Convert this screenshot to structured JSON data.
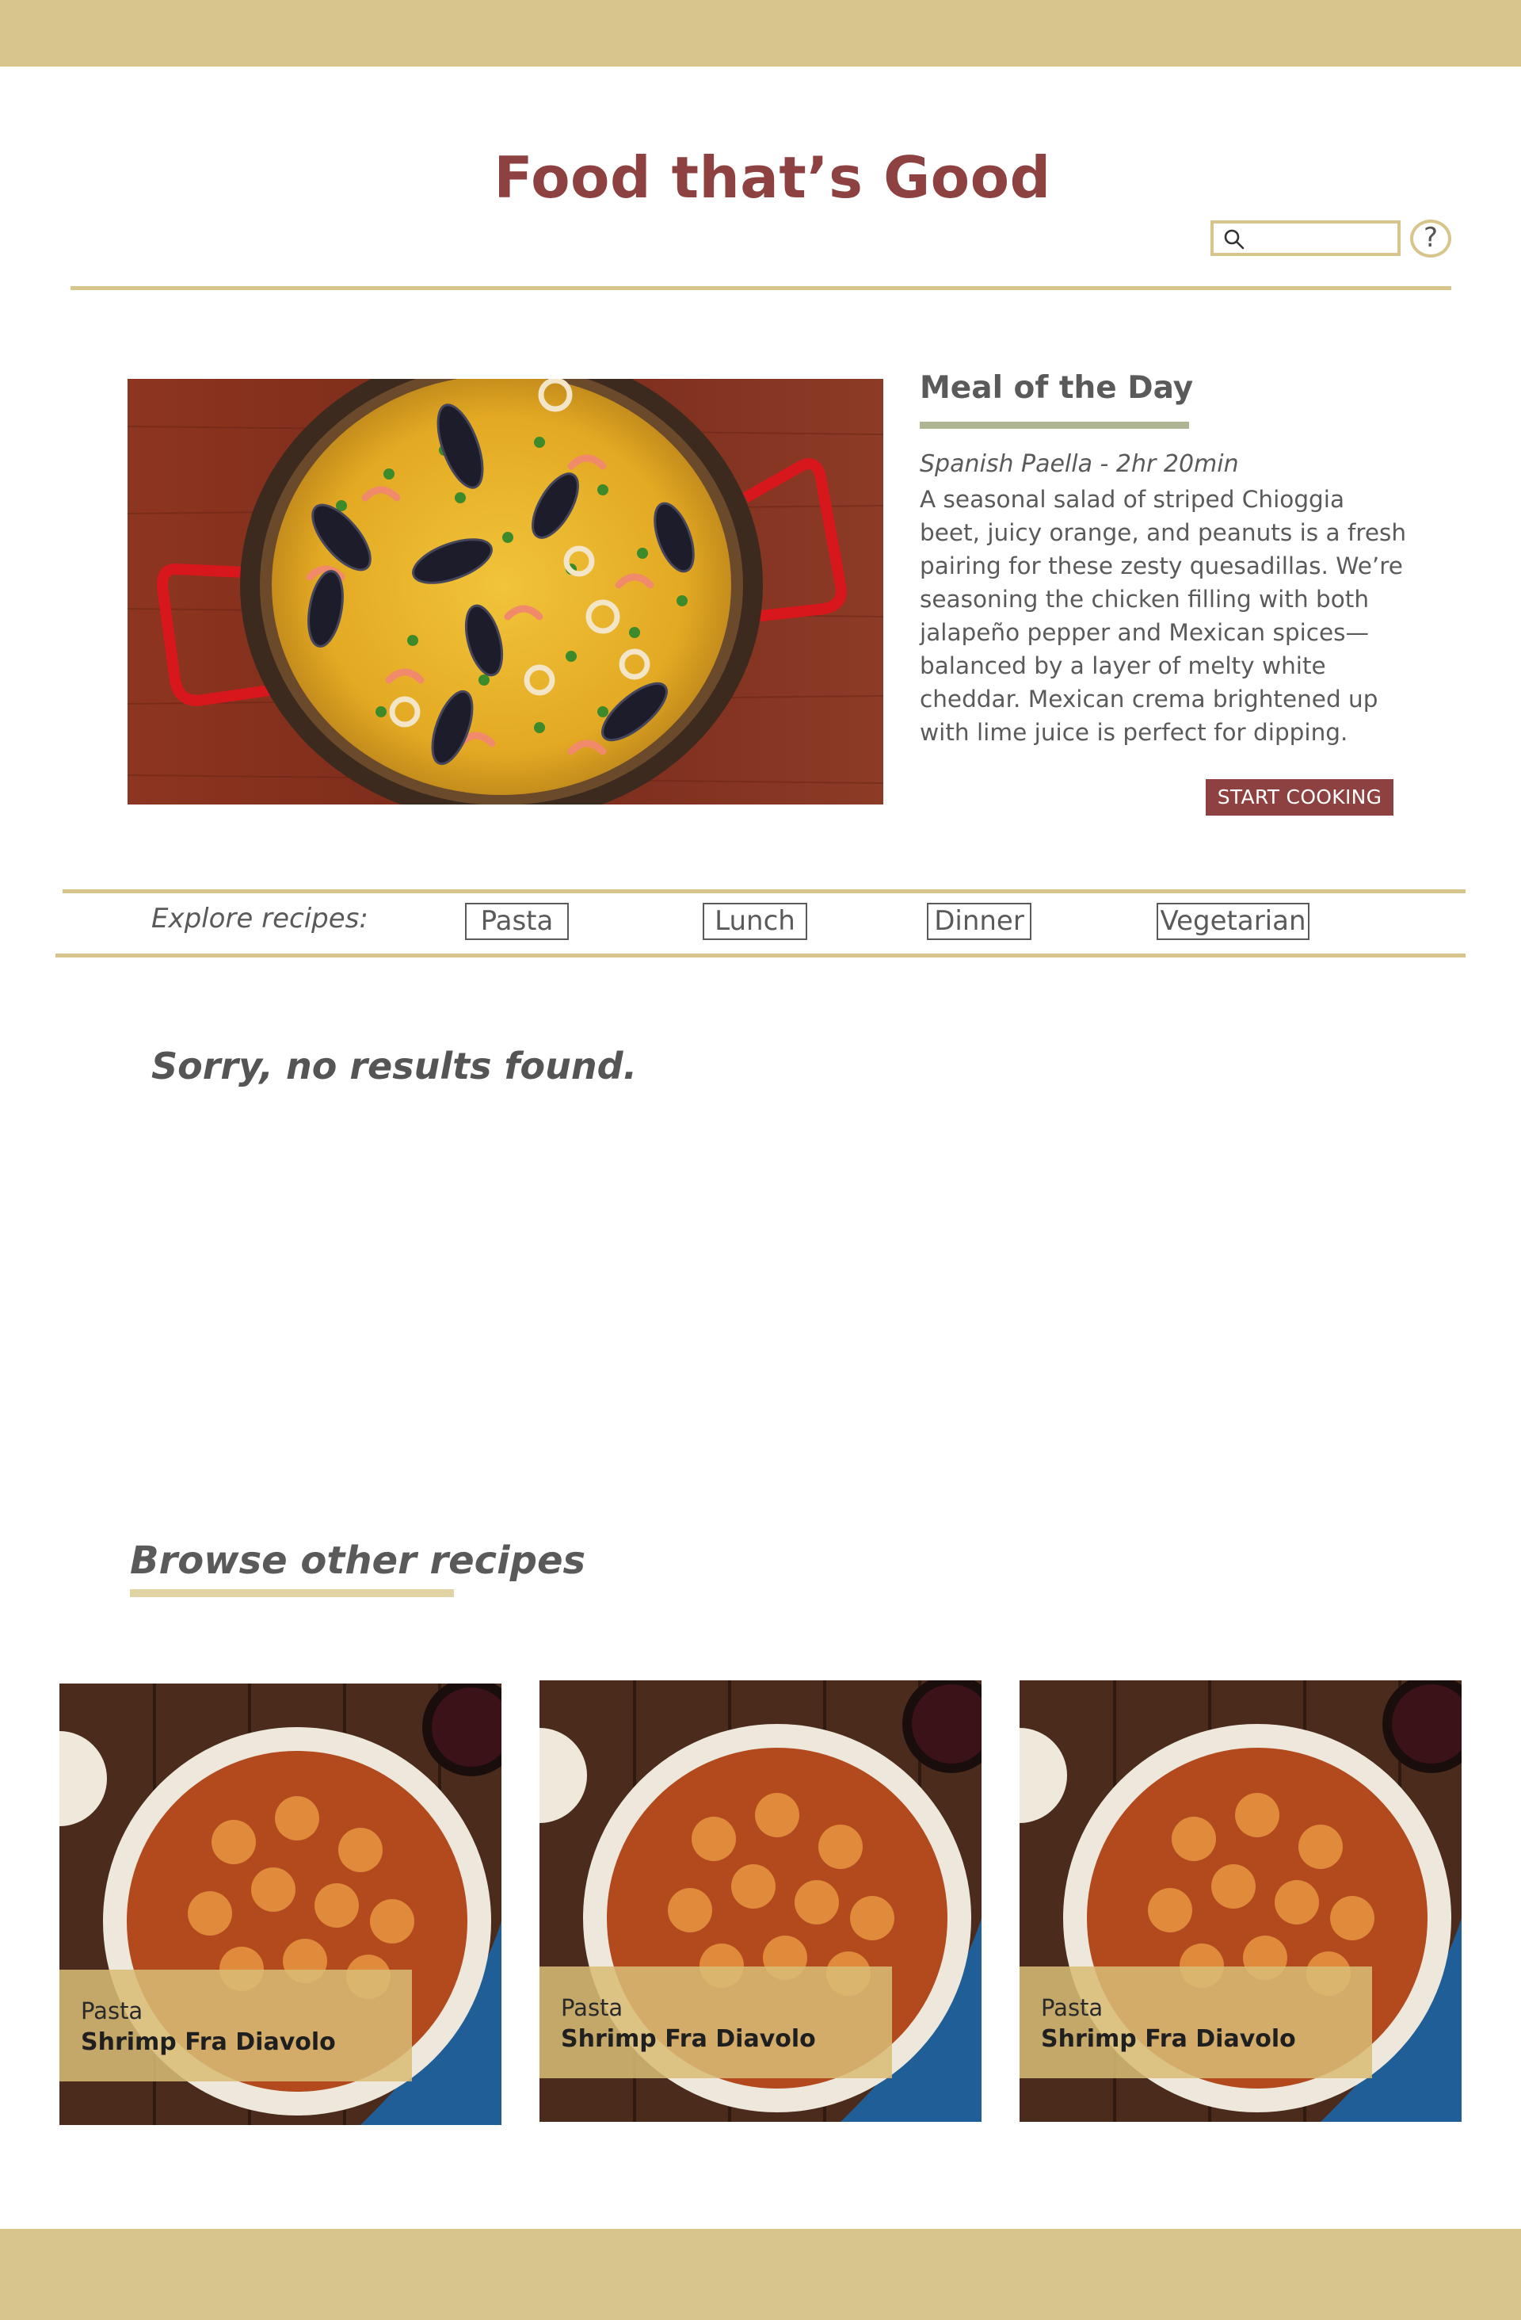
{
  "site": {
    "title": "Food that’s Good",
    "help_label": "?"
  },
  "search": {
    "placeholder": ""
  },
  "meal_of_the_day": {
    "heading": "Meal of the Day",
    "meta": "Spanish Paella - 2hr 20min",
    "description": "A seasonal salad of striped Chioggia beet, juicy orange, and peanuts is a fresh pairing for these zesty quesadillas. We’re seasoning the chicken filling with both jalapeño pepper and Mexican spices—balanced by a layer of melty white cheddar. Mexican crema brightened up with lime juice is perfect for dipping.",
    "button_label": "START COOKING",
    "image": "paella-dish"
  },
  "explore": {
    "label": "Explore recipes:",
    "tags": [
      "Pasta",
      "Lunch",
      "Dinner",
      "Vegetarian"
    ]
  },
  "results": {
    "message": "Sorry, no results found."
  },
  "browse": {
    "heading": "Browse other recipes",
    "cards": [
      {
        "category": "Pasta",
        "name": "Shrimp Fra Diavolo",
        "image": "pasta-bowl"
      },
      {
        "category": "Pasta",
        "name": "Shrimp Fra Diavolo",
        "image": "pasta-bowl"
      },
      {
        "category": "Pasta",
        "name": "Shrimp Fra Diavolo",
        "image": "pasta-bowl"
      }
    ]
  },
  "colors": {
    "band": "#d8c58b",
    "brand": "#8e4141",
    "accent_green": "#adb593",
    "text": "#5a5a5a"
  }
}
